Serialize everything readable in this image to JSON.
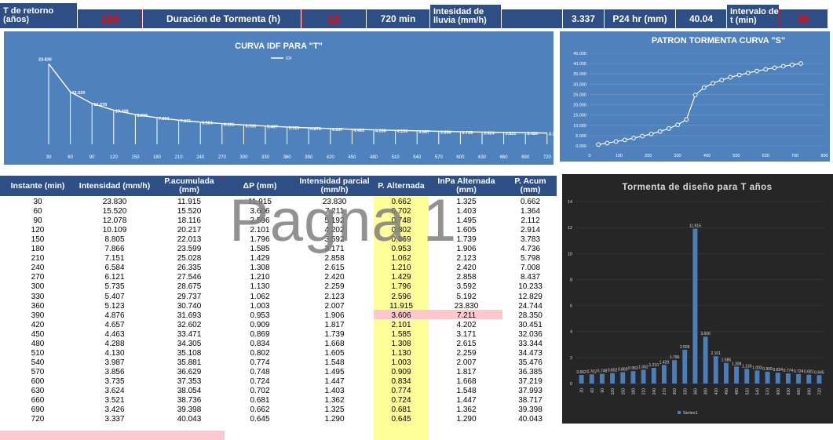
{
  "header": {
    "return_label": "T de retorno (años)",
    "return_value": "100",
    "duration_label": "Duración de Tormenta (h)",
    "duration_value": "12",
    "duration_min": "720 min",
    "intensity_label": "Intesidad de lluvia (mm/h)",
    "intensity_value": "3.337",
    "p24_label": "P24 hr (mm)",
    "p24_value": "40.04",
    "interval_label": "Intervalo de t (min)",
    "interval_value": "30"
  },
  "colors": {
    "header_bg": "#2e4e86",
    "chart_bg": "#4f81bd",
    "dark_bg": "#262626",
    "highlight": "#ffff99",
    "pink": "#ffc7ce",
    "red": "#ff0000",
    "bar": "#4a7ebb"
  },
  "chart_data": [
    {
      "type": "line",
      "title": "CURVA IDF PARA \"T\"",
      "legend": "IDF",
      "legend_position": "top",
      "x": [
        30,
        60,
        90,
        120,
        150,
        180,
        210,
        240,
        270,
        300,
        330,
        360,
        390,
        420,
        450,
        480,
        510,
        540,
        570,
        600,
        630,
        660,
        690,
        720
      ],
      "values": [
        23.83,
        15.52,
        12.078,
        10.109,
        8.805,
        7.866,
        7.151,
        6.584,
        6.121,
        5.735,
        5.407,
        5.123,
        4.876,
        4.657,
        4.463,
        4.288,
        4.13,
        3.987,
        3.856,
        3.735,
        3.624,
        3.521,
        3.426,
        3.337
      ],
      "value_labels": [
        "23.830",
        "15.520",
        "12.078",
        "10.109",
        "8.805",
        "7.866",
        "7.151",
        "6.584",
        "6.121",
        "5.735",
        "5.407",
        "5.123",
        "4.876",
        "4.657",
        "4.463",
        "4.288",
        "4.130",
        "3.987",
        "3.856",
        "3.735",
        "3.624",
        "3.521",
        "3.426",
        "3.337"
      ],
      "x_ticks": [
        "30",
        "60",
        "90",
        "120",
        "150",
        "180",
        "210",
        "240",
        "270",
        "300",
        "330",
        "360",
        "390",
        "420",
        "450",
        "480",
        "510",
        "540",
        "570",
        "600",
        "630",
        "660",
        "690",
        "720"
      ]
    },
    {
      "type": "scatter",
      "title": "PATRON TORMENTA CURVA \"S\"",
      "x": [
        30,
        60,
        90,
        120,
        150,
        180,
        210,
        240,
        270,
        300,
        330,
        360,
        390,
        420,
        450,
        480,
        510,
        540,
        570,
        600,
        630,
        660,
        690,
        720
      ],
      "values": [
        0.662,
        1.364,
        2.112,
        2.914,
        3.783,
        4.736,
        5.798,
        7.008,
        8.437,
        10.233,
        12.829,
        24.744,
        28.35,
        30.451,
        32.036,
        33.344,
        34.473,
        35.476,
        36.385,
        37.219,
        37.993,
        38.717,
        39.398,
        40.043
      ],
      "y_ticks": [
        "0.000",
        "5.000",
        "10.000",
        "15.000",
        "20.000",
        "25.000",
        "30.000",
        "35.000",
        "40.000",
        "45.000"
      ],
      "x_ticks": [
        "0",
        "100",
        "200",
        "300",
        "400",
        "500",
        "600",
        "700",
        "800"
      ],
      "ylim": [
        0,
        45
      ],
      "xlim": [
        0,
        800
      ]
    },
    {
      "type": "bar",
      "title": "Tormenta de diseño para T años",
      "legend": "Series1",
      "legend_position": "bottom",
      "categories": [
        "30",
        "60",
        "90",
        "120",
        "150",
        "180",
        "210",
        "240",
        "270",
        "300",
        "330",
        "360",
        "390",
        "420",
        "450",
        "480",
        "510",
        "540",
        "570",
        "600",
        "630",
        "660",
        "690",
        "720"
      ],
      "values": [
        0.662,
        0.702,
        0.748,
        0.802,
        0.869,
        0.953,
        1.062,
        1.21,
        1.429,
        1.796,
        2.596,
        11.915,
        3.606,
        2.101,
        1.585,
        1.308,
        1.13,
        1.003,
        0.909,
        0.834,
        0.774,
        0.724,
        0.681,
        0.645
      ],
      "value_labels": [
        "0.662",
        "0.702",
        "0.748",
        "0.802",
        "0.869",
        "0.953",
        "1.062",
        "1.210",
        "1.429",
        "1.796",
        "2.596",
        "11.915",
        "3.606",
        "2.101",
        "1.585",
        "1.308",
        "1.130",
        "1.003",
        "0.909",
        "0.834",
        "0.774",
        "0.724",
        "0.681",
        "0.645"
      ],
      "y_ticks": [
        "0",
        "2",
        "4",
        "6",
        "8",
        "10",
        "12",
        "14"
      ],
      "ylim": [
        0,
        14
      ]
    },
    {
      "type": "table",
      "columns": [
        "Instante (min)",
        "Intensidad (mm/h)",
        "P.acumulada (mm)",
        "ΔP (mm)",
        "Intensidad parcial (mm/h)",
        "P. Alternada",
        "InPa Alternada (mm)",
        "P. Acum (mm)"
      ],
      "rows": [
        [
          "30",
          "23.830",
          "11.915",
          "11.915",
          "23.830",
          "0.662",
          "1.325",
          "0.662"
        ],
        [
          "60",
          "15.520",
          "15.520",
          "3.606",
          "7.211",
          "0.702",
          "1.403",
          "1.364"
        ],
        [
          "90",
          "12.078",
          "18.116",
          "2.596",
          "5.192",
          "0.748",
          "1.495",
          "2.112"
        ],
        [
          "120",
          "10.109",
          "20.217",
          "2.101",
          "4.202",
          "0.802",
          "1.605",
          "2.914"
        ],
        [
          "150",
          "8.805",
          "22.013",
          "1.796",
          "3.592",
          "0.869",
          "1.739",
          "3.783"
        ],
        [
          "180",
          "7.866",
          "23.599",
          "1.585",
          "3.171",
          "0.953",
          "1.906",
          "4.736"
        ],
        [
          "210",
          "7.151",
          "25.028",
          "1.429",
          "2.858",
          "1.062",
          "2.123",
          "5.798"
        ],
        [
          "240",
          "6.584",
          "26.335",
          "1.308",
          "2.615",
          "1.210",
          "2.420",
          "7.008"
        ],
        [
          "270",
          "6.121",
          "27.546",
          "1.210",
          "2.420",
          "1.429",
          "2.858",
          "8.437"
        ],
        [
          "300",
          "5.735",
          "28.675",
          "1.130",
          "2.259",
          "1.796",
          "3.592",
          "10.233"
        ],
        [
          "330",
          "5.407",
          "29.737",
          "1.062",
          "2.123",
          "2.596",
          "5.192",
          "12.829"
        ],
        [
          "360",
          "5.123",
          "30.740",
          "1.003",
          "2.007",
          "11.915",
          "23.830",
          "24.744"
        ],
        [
          "390",
          "4.876",
          "31.693",
          "0.953",
          "1.906",
          "3.606",
          "7.211",
          "28.350"
        ],
        [
          "420",
          "4.657",
          "32.602",
          "0.909",
          "1.817",
          "2.101",
          "4.202",
          "30.451"
        ],
        [
          "450",
          "4.463",
          "33.471",
          "0.869",
          "1.739",
          "1.585",
          "3.171",
          "32.036"
        ],
        [
          "480",
          "4.288",
          "34.305",
          "0.834",
          "1.668",
          "1.308",
          "2.615",
          "33.344"
        ],
        [
          "510",
          "4.130",
          "35.108",
          "0.802",
          "1.605",
          "1.130",
          "2.259",
          "34.473"
        ],
        [
          "540",
          "3.987",
          "35.881",
          "0.774",
          "1.548",
          "1.003",
          "2.007",
          "35.476"
        ],
        [
          "570",
          "3.856",
          "36.629",
          "0.748",
          "1.495",
          "0.909",
          "1.817",
          "36.385"
        ],
        [
          "600",
          "3.735",
          "37.353",
          "0.724",
          "1.447",
          "0.834",
          "1.668",
          "37.219"
        ],
        [
          "630",
          "3.624",
          "38.054",
          "0.702",
          "1.403",
          "0.774",
          "1.548",
          "37.993"
        ],
        [
          "660",
          "3.521",
          "38.736",
          "0.681",
          "1.362",
          "0.724",
          "1.447",
          "38.717"
        ],
        [
          "690",
          "3.426",
          "39.398",
          "0.662",
          "1.325",
          "0.681",
          "1.362",
          "39.398"
        ],
        [
          "720",
          "3.337",
          "40.043",
          "0.645",
          "1.290",
          "0.645",
          "1.290",
          "40.043"
        ]
      ]
    }
  ],
  "watermark": "Pagna 1"
}
